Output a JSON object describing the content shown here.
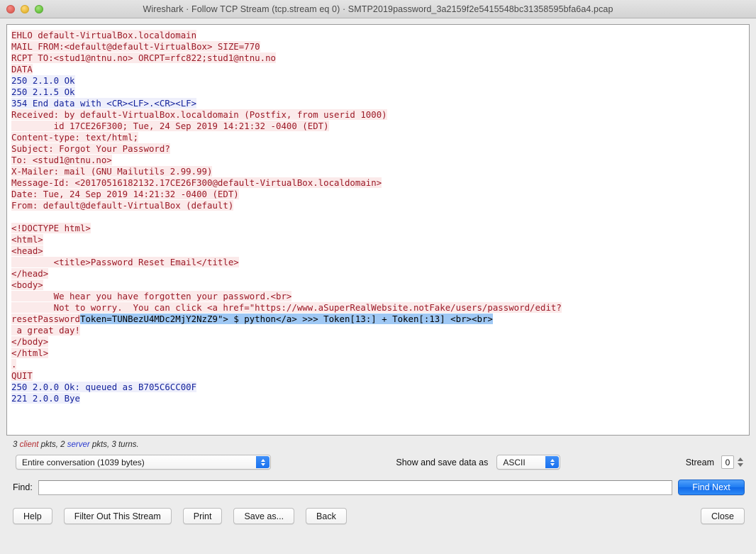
{
  "window": {
    "title": "Wireshark · Follow TCP Stream (tcp.stream eq 0) · SMTP2019password_3a2159f2e5415548bc31358595bfa6a4.pcap",
    "traffic_lights": {
      "close": "close-button",
      "minimize": "minimize-button",
      "maximize": "maximize-button"
    },
    "colors": {
      "client_text": "#9c1a27",
      "client_background": "#fbeaea",
      "server_text": "#14239c",
      "server_background": "#eeeffb",
      "selection": "#9fc8f4",
      "accent": "#1f7cf2"
    }
  },
  "stream": {
    "lines": [
      {
        "segments": [
          {
            "kind": "client",
            "text": "EHLO default-VirtualBox.localdomain"
          }
        ]
      },
      {
        "segments": [
          {
            "kind": "client",
            "text": "MAIL FROM:<default@default-VirtualBox> SIZE=770"
          }
        ]
      },
      {
        "segments": [
          {
            "kind": "client",
            "text": "RCPT TO:<stud1@ntnu.no> ORCPT=rfc822;stud1@ntnu.no"
          }
        ]
      },
      {
        "segments": [
          {
            "kind": "client",
            "text": "DATA"
          }
        ]
      },
      {
        "segments": [
          {
            "kind": "server",
            "text": "250 2.1.0 Ok"
          }
        ]
      },
      {
        "segments": [
          {
            "kind": "server",
            "text": "250 2.1.5 Ok"
          }
        ]
      },
      {
        "segments": [
          {
            "kind": "server",
            "text": "354 End data with <CR><LF>.<CR><LF>"
          }
        ]
      },
      {
        "segments": [
          {
            "kind": "client",
            "text": "Received: by default-VirtualBox.localdomain (Postfix, from userid 1000)"
          }
        ]
      },
      {
        "segments": [
          {
            "kind": "client",
            "text": "        id 17CE26F300; Tue, 24 Sep 2019 14:21:32 -0400 (EDT)"
          }
        ]
      },
      {
        "segments": [
          {
            "kind": "client",
            "text": "Content-type: text/html;"
          }
        ]
      },
      {
        "segments": [
          {
            "kind": "client",
            "text": "Subject: Forgot Your Password?"
          }
        ]
      },
      {
        "segments": [
          {
            "kind": "client",
            "text": "To: <stud1@ntnu.no>"
          }
        ]
      },
      {
        "segments": [
          {
            "kind": "client",
            "text": "X-Mailer: mail (GNU Mailutils 2.99.99)"
          }
        ]
      },
      {
        "segments": [
          {
            "kind": "client",
            "text": "Message-Id: <20170516182132.17CE26F300@default-VirtualBox.localdomain>"
          }
        ]
      },
      {
        "segments": [
          {
            "kind": "client",
            "text": "Date: Tue, 24 Sep 2019 14:21:32 -0400 (EDT)"
          }
        ]
      },
      {
        "segments": [
          {
            "kind": "client",
            "text": "From: default@default-VirtualBox (default)"
          }
        ]
      },
      {
        "segments": [
          {
            "kind": "blank",
            "text": ""
          }
        ]
      },
      {
        "segments": [
          {
            "kind": "client",
            "text": "<!DOCTYPE html>"
          }
        ]
      },
      {
        "segments": [
          {
            "kind": "client",
            "text": "<html>"
          }
        ]
      },
      {
        "segments": [
          {
            "kind": "client",
            "text": "<head>"
          }
        ]
      },
      {
        "segments": [
          {
            "kind": "client",
            "text": "        <title>Password Reset Email</title>"
          }
        ]
      },
      {
        "segments": [
          {
            "kind": "client",
            "text": "</head>"
          }
        ]
      },
      {
        "segments": [
          {
            "kind": "client",
            "text": "<body>"
          }
        ]
      },
      {
        "segments": [
          {
            "kind": "client",
            "text": "        We hear you have forgotten your password.<br>"
          }
        ]
      },
      {
        "segments": [
          {
            "kind": "client",
            "text": "        Not to worry.  You can click <a href=\"https://www.aSuperRealWebsite.notFake/users/password/edit?"
          }
        ]
      },
      {
        "segments": [
          {
            "kind": "client",
            "text": "resetPassword"
          },
          {
            "kind": "selected",
            "text": "Token=TUNBezU4MDc2MjY2NzZ9\"> $ python</a> >>> Token[13:] + Token[:13] <br><br>"
          }
        ]
      },
      {
        "segments": [
          {
            "kind": "client",
            "text": " a great day!"
          }
        ]
      },
      {
        "segments": [
          {
            "kind": "client",
            "text": "</body>"
          }
        ]
      },
      {
        "segments": [
          {
            "kind": "client",
            "text": "</html>"
          }
        ]
      },
      {
        "segments": [
          {
            "kind": "client",
            "text": "."
          }
        ]
      },
      {
        "segments": [
          {
            "kind": "client",
            "text": "QUIT"
          }
        ]
      },
      {
        "segments": [
          {
            "kind": "server",
            "text": "250 2.0.0 Ok: queued as B705C6CC00F"
          }
        ]
      },
      {
        "segments": [
          {
            "kind": "server",
            "text": "221 2.0.0 Bye"
          }
        ]
      }
    ]
  },
  "status": {
    "client_count": "3",
    "client_word": "client",
    "client_suffix": " pkts, ",
    "server_count": "2",
    "server_word": "server",
    "server_suffix": " pkts, 3 turns."
  },
  "controls": {
    "conversation_selected": "Entire conversation (1039 bytes)",
    "show_save_label": "Show and save data as",
    "format_selected": "ASCII",
    "stream_label": "Stream",
    "stream_value": "0"
  },
  "find": {
    "label": "Find:",
    "value": "",
    "placeholder": "",
    "find_next_label": "Find Next"
  },
  "buttons": {
    "help": "Help",
    "filter_out": "Filter Out This Stream",
    "print": "Print",
    "save_as": "Save as...",
    "back": "Back",
    "close": "Close"
  }
}
